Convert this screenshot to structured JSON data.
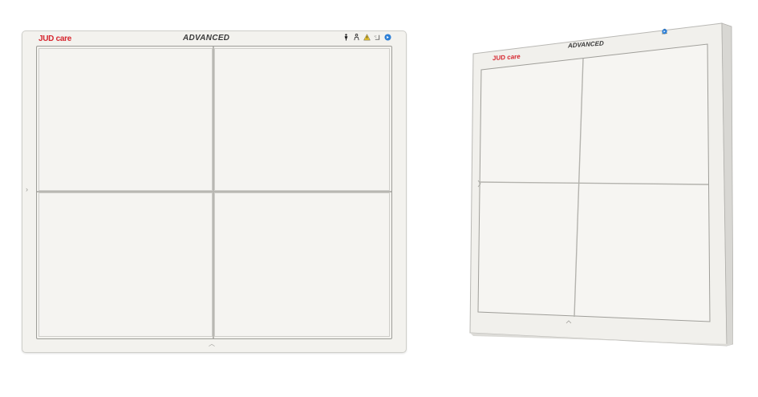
{
  "front_panel": {
    "brand_name": "JUD",
    "brand_suffix": "care",
    "model": "ADVANCED"
  },
  "back_panel": {
    "brand_name": "JUD",
    "brand_suffix": "care",
    "model": "ADVANCED"
  },
  "colors": {
    "brand": "#d6262f",
    "panel": "#f3f2ee",
    "border": "#9e9e99"
  },
  "icons": [
    "person-icon",
    "operator-icon",
    "warning-icon",
    "temperature-icon",
    "wireless-icon"
  ]
}
